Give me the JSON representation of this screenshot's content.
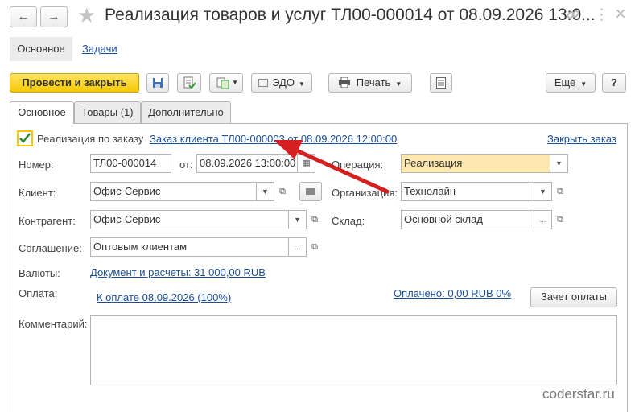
{
  "window": {
    "title": "Реализация товаров и услуг ТЛ00-000014 от 08.09.2026 13:0...",
    "back_icon": "←",
    "forward_icon": "→",
    "star_icon": "★",
    "link_icon": "🔗",
    "more_icon": "⋮",
    "close_icon": "×"
  },
  "sections": {
    "main": "Основное",
    "tasks": "Задачи"
  },
  "toolbar": {
    "post_close": "Провести и закрыть",
    "edo": "ЭДО",
    "print": "Печать",
    "more": "Еще",
    "help": "?"
  },
  "tabs": [
    {
      "label": "Основное"
    },
    {
      "label": "Товары (1)"
    },
    {
      "label": "Дополнительно"
    }
  ],
  "form": {
    "order_checkbox_label": "Реализация по заказу",
    "order_link": "Заказ клиента ТЛ00-000003 от 08.09.2026 12:00:00",
    "close_order": "Закрыть заказ",
    "number_label": "Номер:",
    "number_value": "ТЛ00-000014",
    "from_label": "от:",
    "date_value": "08.09.2026 13:00:00",
    "operation_label": "Операция:",
    "operation_value": "Реализация",
    "client_label": "Клиент:",
    "client_value": "Офис-Сервис",
    "org_label": "Организация:",
    "org_value": "Технолайн",
    "contractor_label": "Контрагент:",
    "contractor_value": "Офис-Сервис",
    "warehouse_label": "Склад:",
    "warehouse_value": "Основной склад",
    "agreement_label": "Соглашение:",
    "agreement_value": "Оптовым клиентам",
    "currency_label": "Валюты:",
    "currency_link": "Документ и расчеты: 31 000,00 RUB",
    "payment_label": "Оплата:",
    "payment_link": "К оплате 08.09.2026 (100%)",
    "paid_link": "Оплачено: 0,00 RUB 0%",
    "offset_button": "Зачет оплаты",
    "comment_label": "Комментарий:",
    "comment_value": ""
  },
  "watermark": "coderstar.ru",
  "colors": {
    "accent_yellow": "#f5c800",
    "link_blue": "#1a4f99",
    "arrow_red": "#d42020",
    "highlight": "#fde8b0"
  }
}
